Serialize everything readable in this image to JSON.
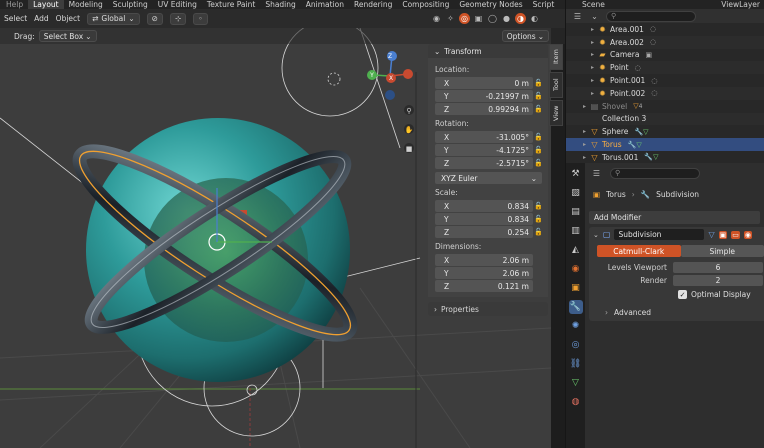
{
  "menu": {
    "items": [
      "Help",
      "Layout",
      "Modeling",
      "Sculpting",
      "UV Editing",
      "Texture Paint",
      "Shading",
      "Animation",
      "Rendering",
      "Compositing",
      "Geometry Nodes",
      "Script"
    ],
    "active": "Layout"
  },
  "viewport_header": {
    "menus": [
      "Select",
      "Add",
      "Object"
    ],
    "orientation": "Global"
  },
  "tool_header": {
    "drag_label": "Drag:",
    "drag_mode": "Select Box",
    "options": "Options"
  },
  "npanel": {
    "title": "Transform",
    "location_label": "Location:",
    "location": [
      {
        "axis": "X",
        "value": "0 m"
      },
      {
        "axis": "Y",
        "value": "-0.21997 m"
      },
      {
        "axis": "Z",
        "value": "0.99294 m"
      }
    ],
    "rotation_label": "Rotation:",
    "rotation": [
      {
        "axis": "X",
        "value": "-31.005°"
      },
      {
        "axis": "Y",
        "value": "-4.1725°"
      },
      {
        "axis": "Z",
        "value": "-2.5715°"
      }
    ],
    "rotation_mode": "XYZ Euler",
    "scale_label": "Scale:",
    "scale": [
      {
        "axis": "X",
        "value": "0.834"
      },
      {
        "axis": "Y",
        "value": "0.834"
      },
      {
        "axis": "Z",
        "value": "0.254"
      }
    ],
    "dimensions_label": "Dimensions:",
    "dimensions": [
      {
        "axis": "X",
        "value": "2.06 m"
      },
      {
        "axis": "Y",
        "value": "2.06 m"
      },
      {
        "axis": "Z",
        "value": "0.121 m"
      }
    ],
    "properties_title": "Properties",
    "tabs": [
      "Item",
      "Tool",
      "View"
    ]
  },
  "outliner": {
    "scene": "Scene",
    "view_layer": "ViewLayer",
    "rows": [
      {
        "name": "Area.001",
        "icon": "light-icon",
        "depth": 2
      },
      {
        "name": "Area.002",
        "icon": "light-icon",
        "depth": 2
      },
      {
        "name": "Camera",
        "icon": "camera-icon",
        "depth": 2
      },
      {
        "name": "Point",
        "icon": "light-icon",
        "depth": 2
      },
      {
        "name": "Point.001",
        "icon": "light-icon",
        "depth": 2
      },
      {
        "name": "Point.002",
        "icon": "light-icon",
        "depth": 2
      },
      {
        "name": "Shovel",
        "icon": "collection-icon",
        "depth": 1,
        "badge": "4"
      },
      {
        "name": "Collection 3",
        "icon": "collection-icon",
        "depth": 1
      },
      {
        "name": "Sphere",
        "icon": "mesh-icon",
        "depth": 1
      },
      {
        "name": "Torus",
        "icon": "mesh-icon",
        "depth": 1,
        "selected": true
      },
      {
        "name": "Torus.001",
        "icon": "mesh-icon",
        "depth": 1
      }
    ]
  },
  "properties": {
    "object": "Torus",
    "modifier_context": "Subdivision",
    "add_modifier": "Add Modifier",
    "modifier_name": "Subdivision",
    "mode_catmull": "Catmull-Clark",
    "mode_simple": "Simple",
    "levels_viewport_label": "Levels Viewport",
    "levels_viewport": "6",
    "render_label": "Render",
    "render": "2",
    "optimal_display": "Optimal Display",
    "advanced": "Advanced"
  },
  "colors": {
    "selected_orange": "#f0a030",
    "active_tab": "#cf5326",
    "outliner_select": "#334d80"
  }
}
